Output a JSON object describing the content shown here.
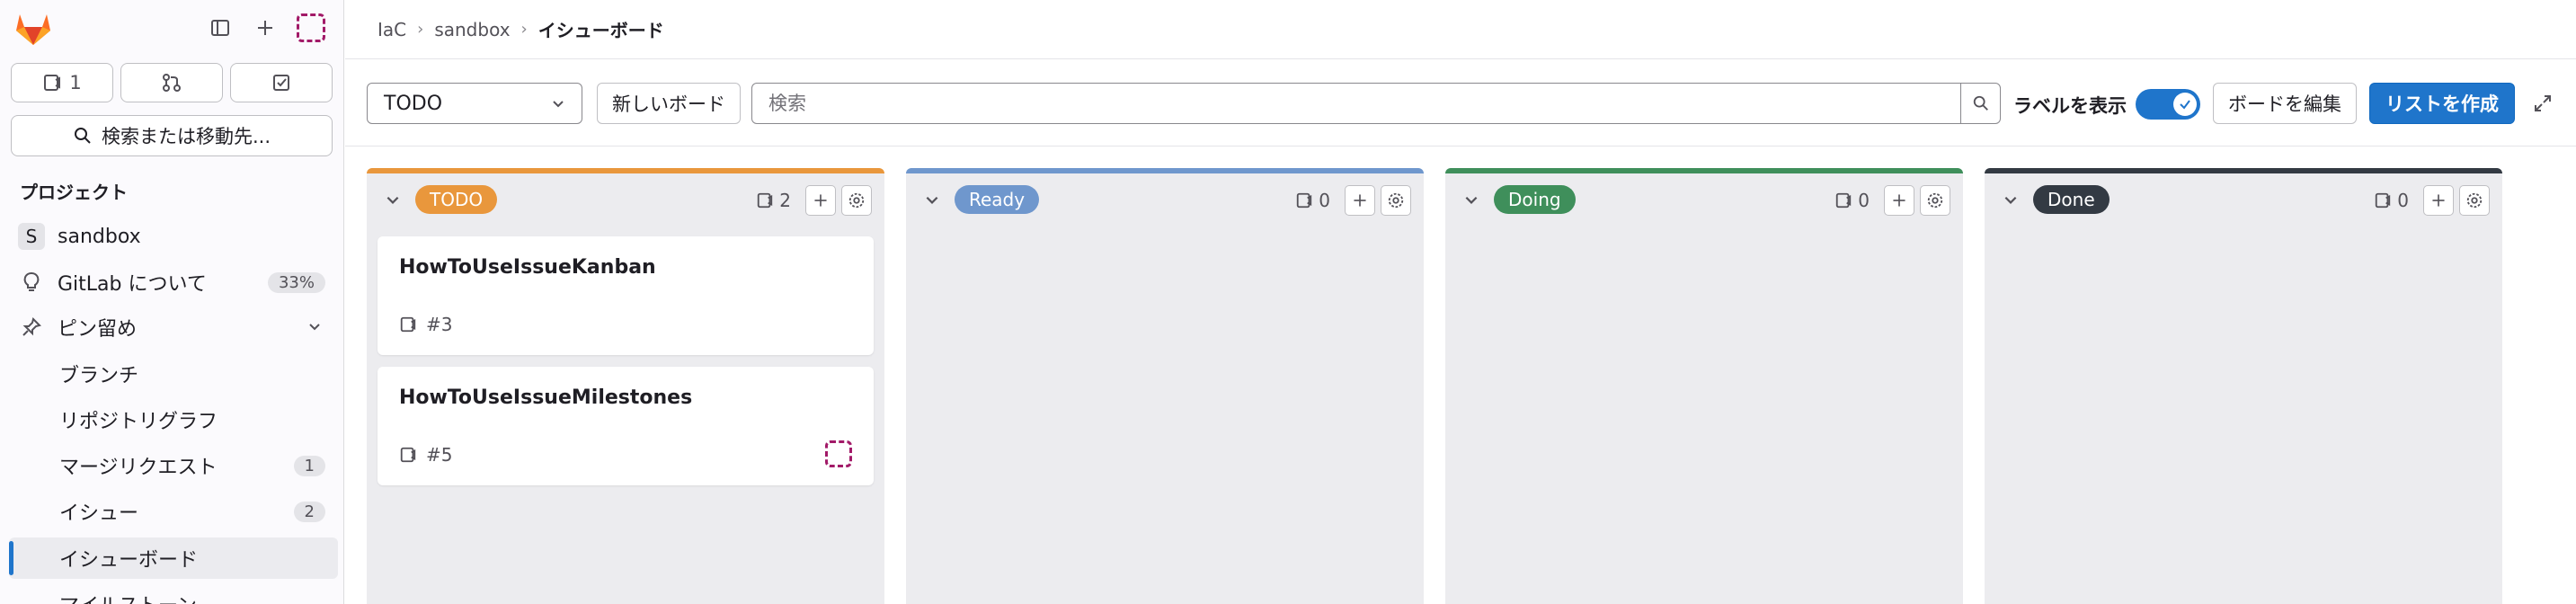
{
  "sidebar": {
    "counters": [
      {
        "icon": "issues-icon",
        "count": "1"
      },
      {
        "icon": "merge-request-icon",
        "count": ""
      },
      {
        "icon": "todo-icon",
        "count": ""
      }
    ],
    "search_label": "検索または移動先...",
    "section_title": "プロジェクト",
    "project": {
      "letter": "S",
      "name": "sandbox"
    },
    "about": {
      "label": "GitLab について",
      "badge": "33%"
    },
    "pinned": {
      "label": "ピン留め"
    },
    "items": [
      {
        "label": "ブランチ",
        "badge": ""
      },
      {
        "label": "リポジトリグラフ",
        "badge": ""
      },
      {
        "label": "マージリクエスト",
        "badge": "1"
      },
      {
        "label": "イシュー",
        "badge": "2"
      },
      {
        "label": "イシューボード",
        "badge": "",
        "active": true
      },
      {
        "label": "マイルストーン",
        "badge": ""
      }
    ]
  },
  "breadcrumb": {
    "group": "IaC",
    "project": "sandbox",
    "current": "イシューボード"
  },
  "filterbar": {
    "board_select": "TODO",
    "new_board": "新しいボード",
    "search_placeholder": "検索",
    "show_labels": "ラベルを表示",
    "show_labels_on": true,
    "edit_board": "ボードを編集",
    "create_list": "リストを作成"
  },
  "lists": [
    {
      "label": "TODO",
      "color": "#e9973c",
      "count": "2",
      "cards": [
        {
          "title": "HowToUseIssueKanban",
          "ref": "#3",
          "assignee": false
        },
        {
          "title": "HowToUseIssueMilestones",
          "ref": "#5",
          "assignee": true
        }
      ]
    },
    {
      "label": "Ready",
      "color": "#6f97cd",
      "count": "0",
      "cards": []
    },
    {
      "label": "Doing",
      "color": "#3f8f5b",
      "count": "0",
      "cards": []
    },
    {
      "label": "Done",
      "color": "#333a43",
      "count": "0",
      "cards": []
    }
  ]
}
